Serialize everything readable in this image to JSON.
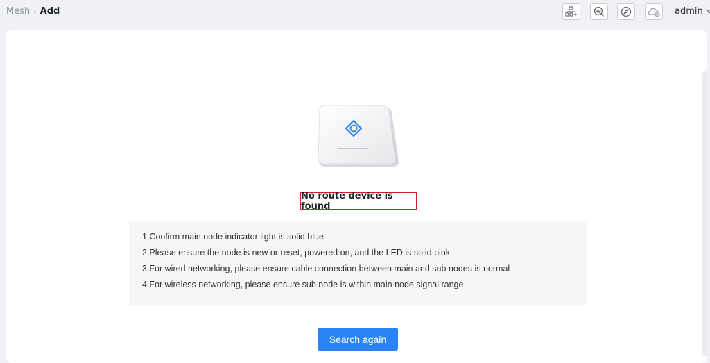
{
  "header": {
    "breadcrumb": {
      "root": "Mesh",
      "current": "Add"
    },
    "icons": [
      "network-add-icon",
      "diagnostics-icon",
      "compass-icon",
      "cloud-disconnected-icon"
    ],
    "user": "admin"
  },
  "main": {
    "status_message": "No route device is found",
    "tips": [
      "1.Confirm main node indicator light is solid blue",
      "2.Please ensure the node is new or reset, powered on, and the LED is solid pink.",
      "3.For wired networking, please ensure cable connection between main and sub nodes is normal",
      "4.For wireless networking, please ensure sub node is within main node signal range"
    ],
    "search_button": "Search again"
  },
  "colors": {
    "accent": "#2a84f5",
    "highlight_border": "#d0202b",
    "background": "#f0f1f5"
  }
}
